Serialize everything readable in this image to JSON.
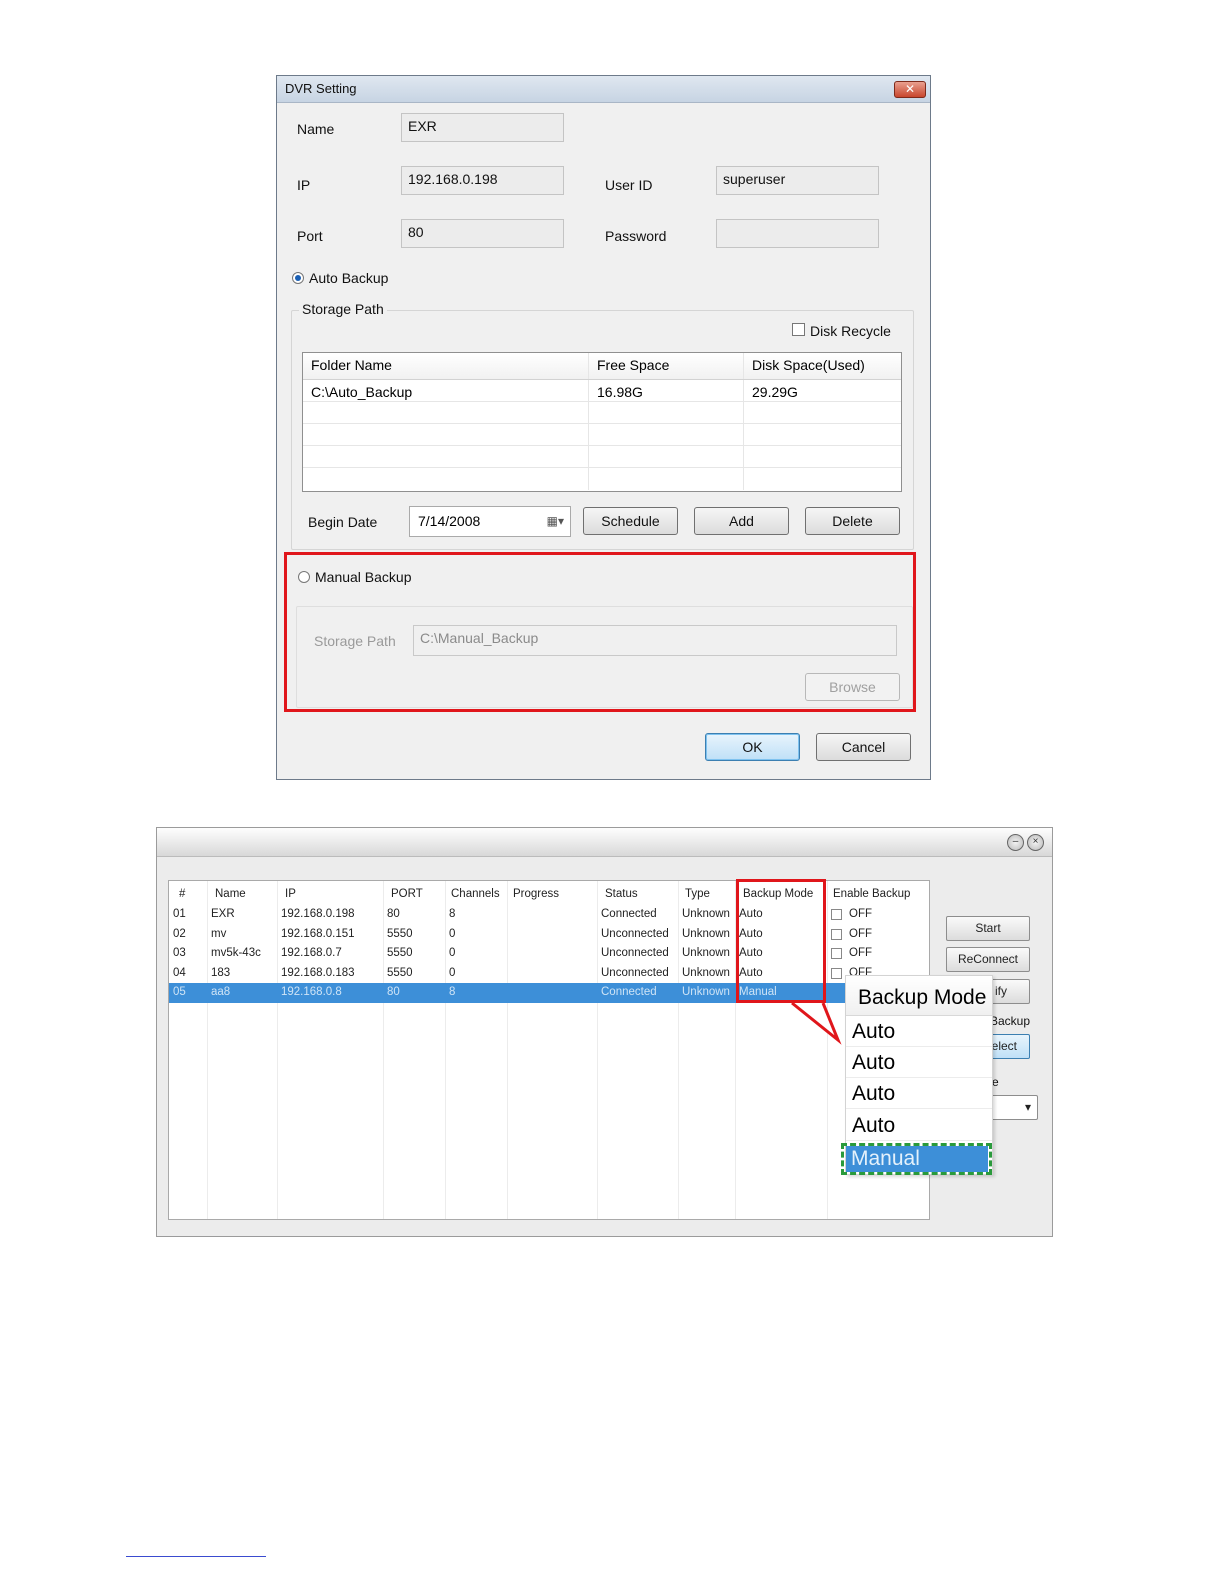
{
  "dialog": {
    "title": "DVR Setting",
    "close_glyph": "✕",
    "name_label": "Name",
    "name_value": "EXR",
    "ip_label": "IP",
    "ip_value": "192.168.0.198",
    "userid_label": "User ID",
    "userid_value": "superuser",
    "port_label": "Port",
    "port_value": "80",
    "password_label": "Password",
    "password_value": "",
    "auto_backup_label": "Auto Backup",
    "auto_backup_selected": true,
    "storage_path_label": "Storage Path",
    "disk_recycle_label": "Disk Recycle",
    "disk_recycle_checked": false,
    "storage_table": {
      "columns": [
        "Folder Name",
        "Free Space",
        "Disk Space(Used)"
      ],
      "rows": [
        [
          "C:\\Auto_Backup",
          "16.98G",
          "29.29G"
        ]
      ]
    },
    "begin_date_label": "Begin Date",
    "begin_date_value": "7/14/2008",
    "schedule_button": "Schedule",
    "add_button": "Add",
    "delete_button": "Delete",
    "manual_backup_label": "Manual Backup",
    "manual_backup_selected": false,
    "manual_storage_path_label": "Storage Path",
    "manual_storage_path_value": "C:\\Manual_Backup",
    "browse_button": "Browse",
    "ok_button": "OK",
    "cancel_button": "Cancel",
    "highlight_color": "#e0161b"
  },
  "backup_window": {
    "columns": [
      "#",
      "Name",
      "IP",
      "PORT",
      "Channels",
      "Progress",
      "Status",
      "Type",
      "Backup Mode",
      "Enable Backup"
    ],
    "rows": [
      [
        "01",
        "EXR",
        "192.168.0.198",
        "80",
        "8",
        "",
        "Connected",
        "Unknown",
        "Auto",
        "OFF"
      ],
      [
        "02",
        "mv",
        "192.168.0.151",
        "5550",
        "0",
        "",
        "Unconnected",
        "Unknown",
        "Auto",
        "OFF"
      ],
      [
        "03",
        "mv5k-43c",
        "192.168.0.7",
        "5550",
        "0",
        "",
        "Unconnected",
        "Unknown",
        "Auto",
        "OFF"
      ],
      [
        "04",
        "183",
        "192.168.0.183",
        "5550",
        "0",
        "",
        "Unconnected",
        "Unknown",
        "Auto",
        "OFF"
      ],
      [
        "05",
        "aa8",
        "192.168.0.8",
        "80",
        "8",
        "",
        "Connected",
        "Unknown",
        "Manual",
        ""
      ]
    ],
    "selected_row": 4,
    "side_buttons": [
      "Start",
      "ReConnect",
      "ify",
      "elect"
    ],
    "side_label": "Backup",
    "side_label2": "e",
    "selection_color": "#3d8fd8",
    "zoom_callout": {
      "header": "Backup Mode",
      "items": [
        "Auto",
        "Auto",
        "Auto",
        "Auto",
        "Manual"
      ],
      "selected_index": 4,
      "selected_outline_color": "#2a9a3c"
    }
  }
}
